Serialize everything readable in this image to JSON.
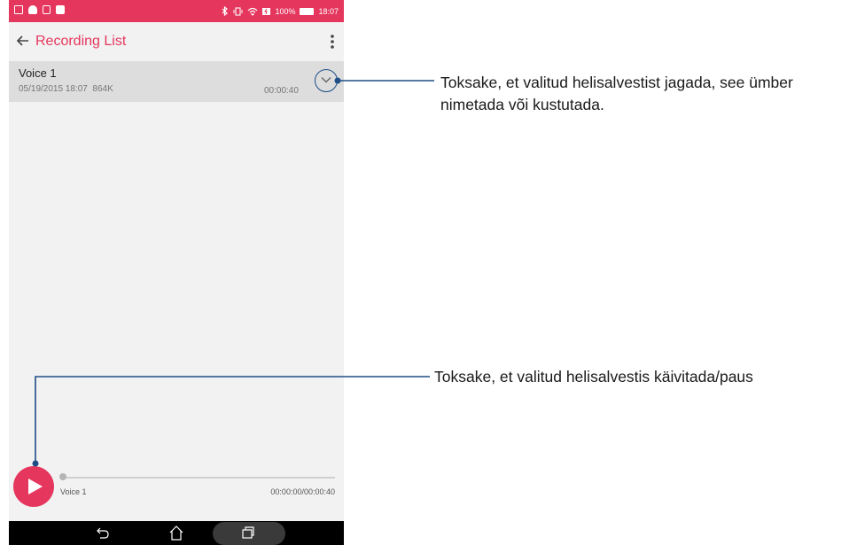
{
  "status_bar": {
    "signal_percent": "100%",
    "time": "18:07",
    "accent_color": "#e5365d"
  },
  "app_bar": {
    "back_icon": "arrow-left-icon",
    "title": "Recording List",
    "menu_icon": "more-vert-icon"
  },
  "recordings": [
    {
      "name": "Voice 1",
      "date_time": "05/19/2015 18:07",
      "size": "864K",
      "duration": "00:00:40",
      "action_icon": "chevron-down-icon"
    }
  ],
  "player": {
    "play_icon": "play-icon",
    "track_name": "Voice 1",
    "time": "00:00:00/00:00:40",
    "progress": 0
  },
  "nav_bar": {
    "icons": [
      "back-icon",
      "home-icon",
      "recents-icon"
    ]
  },
  "callouts": {
    "expand_text": "Toksake, et valitud helisalvestist jagada, see ümber nimetada või kustutada.",
    "play_text": "Toksake, et valitud helisalvestis käivitada/paus",
    "line_color": "#1d4e86"
  }
}
